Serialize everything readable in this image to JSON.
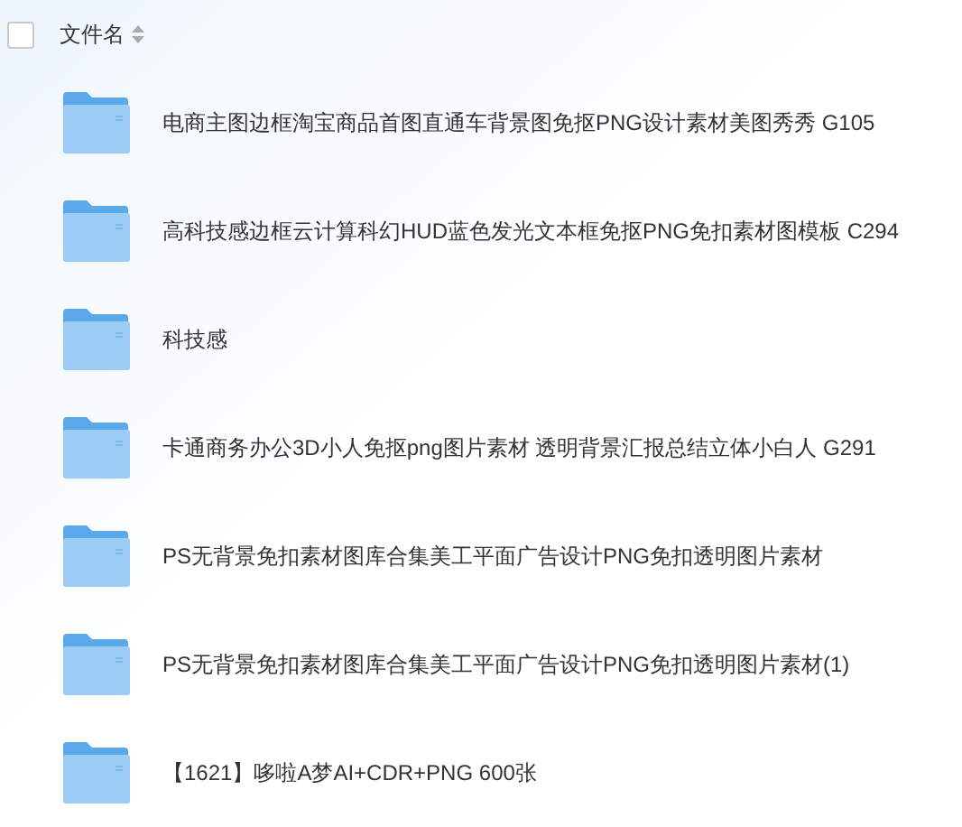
{
  "header": {
    "checkbox": {
      "checked": false
    },
    "column": "文件名"
  },
  "files": [
    {
      "name": "电商主图边框淘宝商品首图直通车背景图免抠PNG设计素材美图秀秀 G105"
    },
    {
      "name": "高科技感边框云计算科幻HUD蓝色发光文本框免抠PNG免扣素材图模板 C294"
    },
    {
      "name": "科技感"
    },
    {
      "name": "卡通商务办公3D小人免抠png图片素材 透明背景汇报总结立体小白人 G291"
    },
    {
      "name": "PS无背景免扣素材图库合集美工平面广告设计PNG免扣透明图片素材"
    },
    {
      "name": "PS无背景免扣素材图库合集美工平面广告设计PNG免扣透明图片素材(1)"
    },
    {
      "name": "【1621】哆啦A梦AI+CDR+PNG 600张"
    }
  ]
}
